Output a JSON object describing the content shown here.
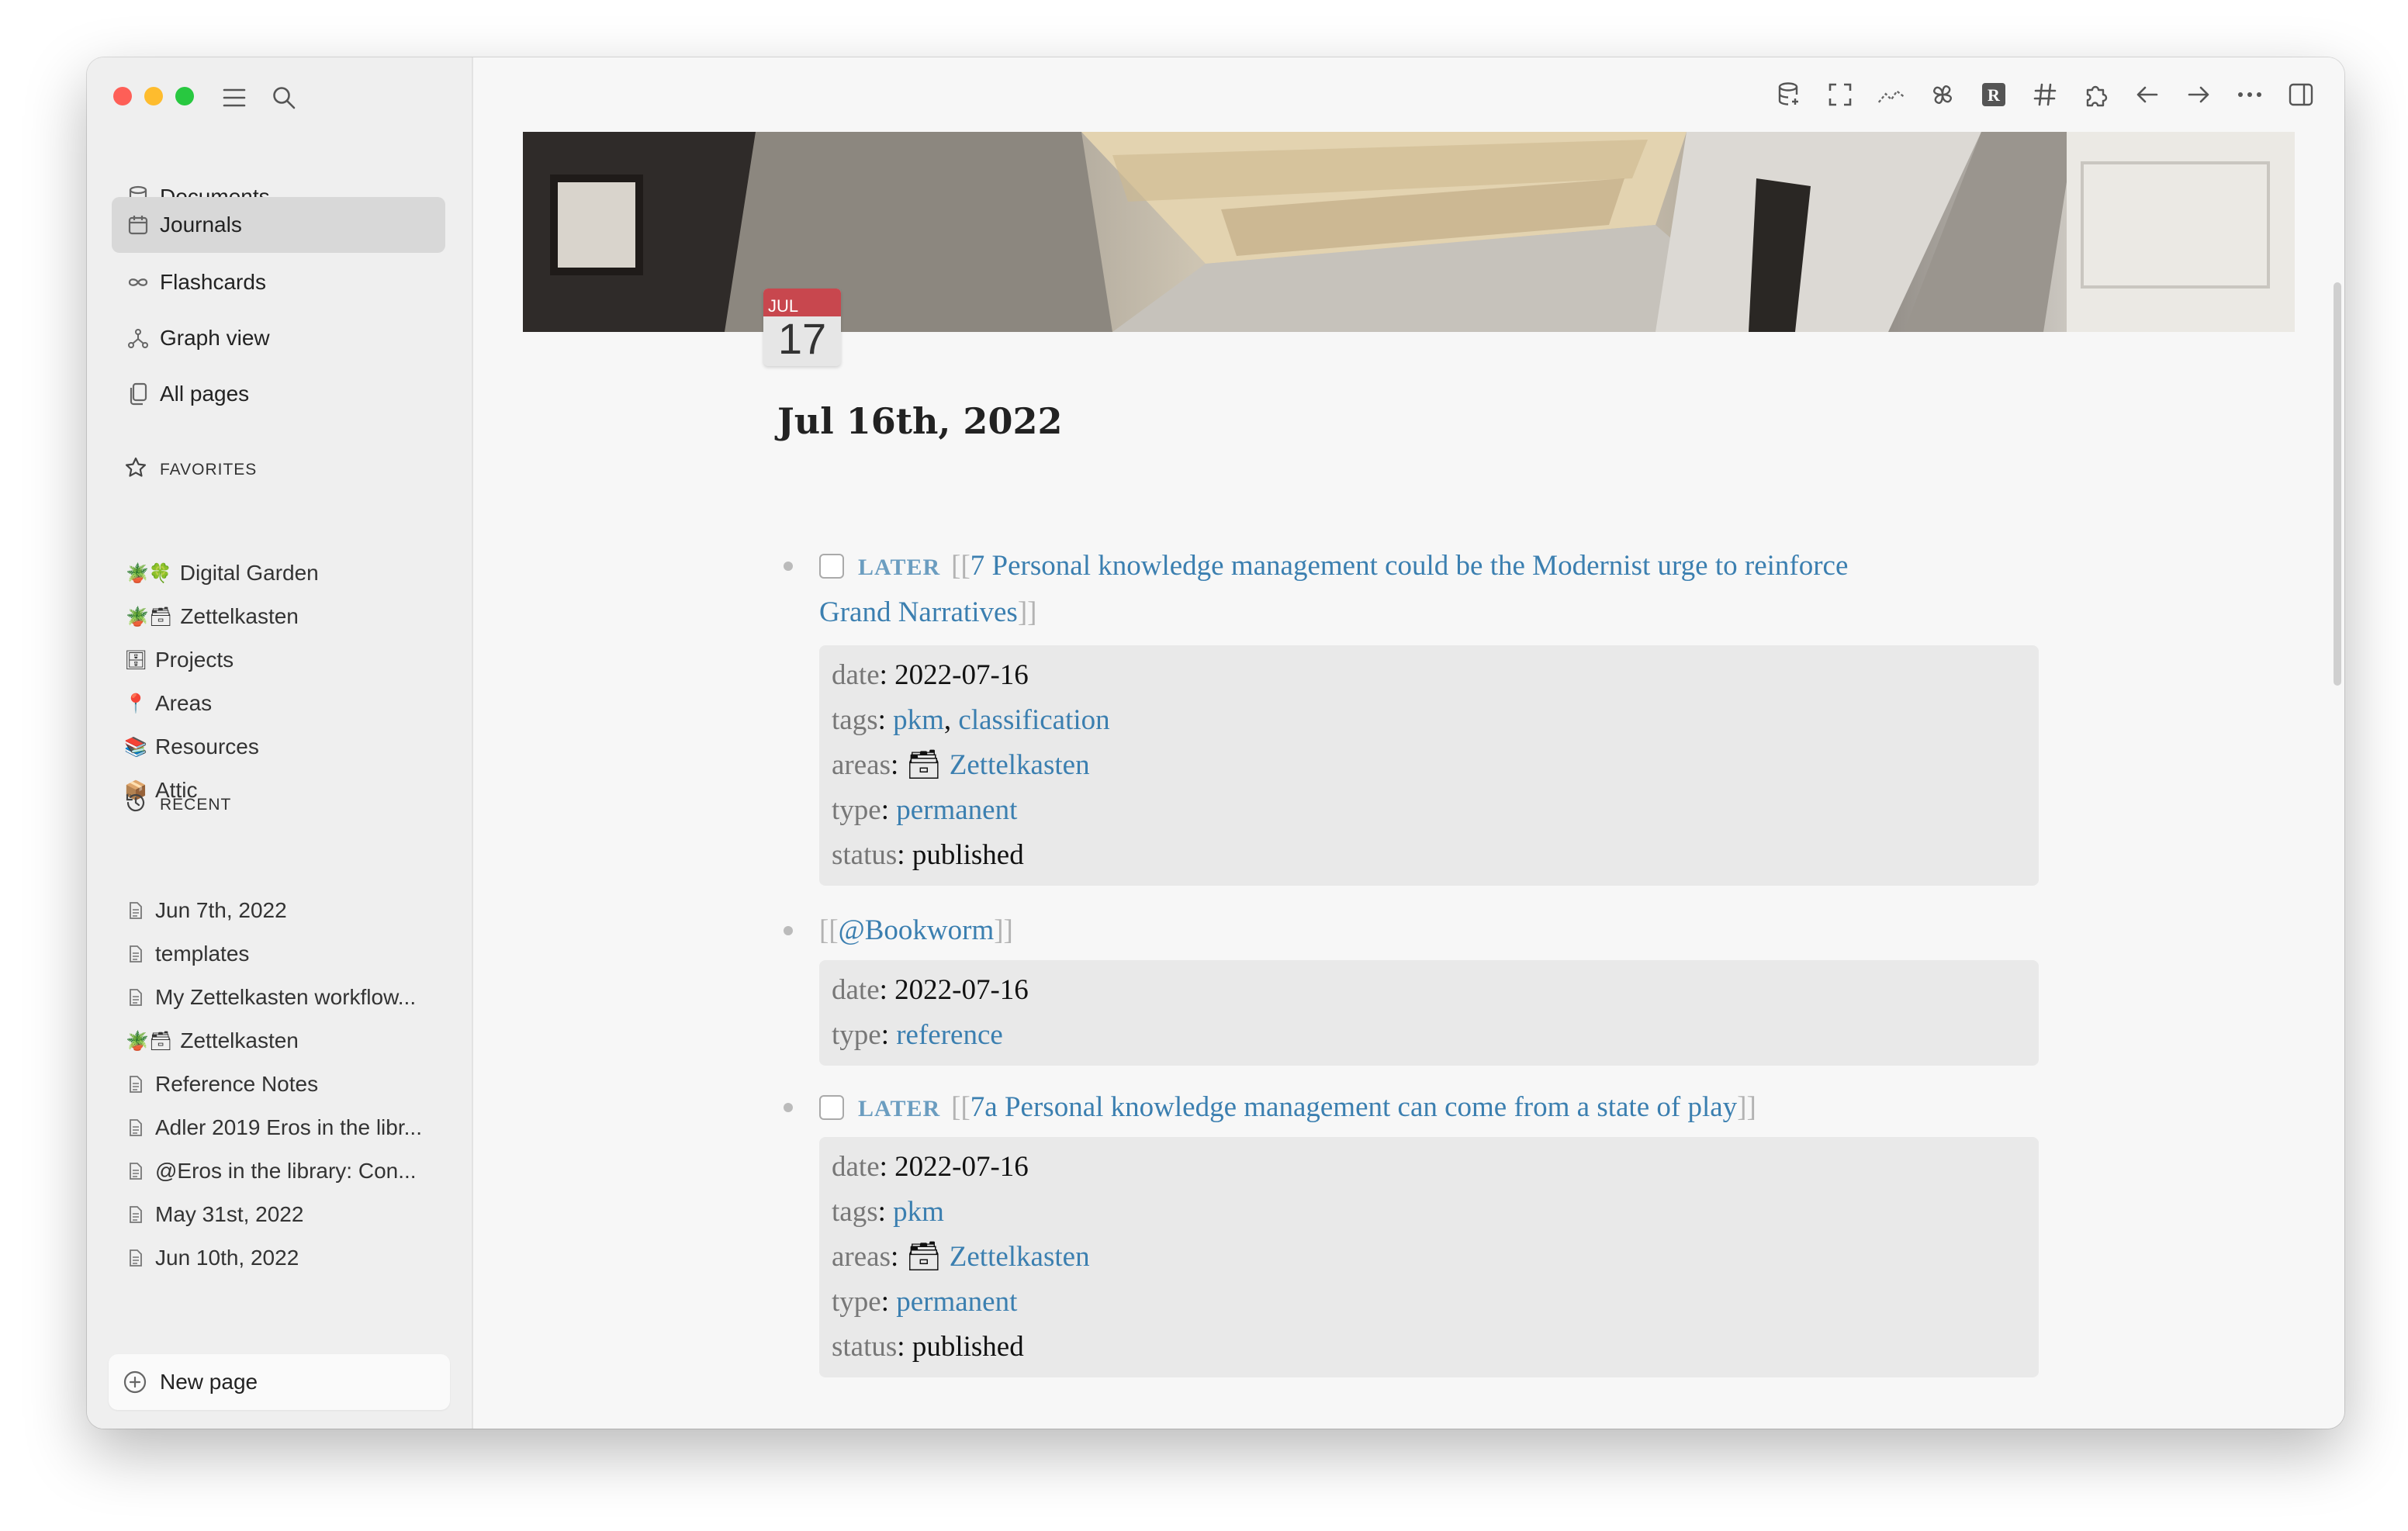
{
  "sidebar": {
    "nav": [
      {
        "label": "Documents",
        "icon": "database-icon"
      },
      {
        "label": "Journals",
        "icon": "calendar-icon",
        "active": true
      },
      {
        "label": "Flashcards",
        "icon": "infinity-icon"
      },
      {
        "label": "Graph view",
        "icon": "graph-icon"
      },
      {
        "label": "All pages",
        "icon": "pages-icon"
      }
    ],
    "favorites_title": "FAVORITES",
    "favorites": [
      {
        "icon": "🪴🍀",
        "label": "Digital Garden"
      },
      {
        "icon": "🪴🗃",
        "label": "Zettelkasten"
      },
      {
        "icon": "🗄",
        "label": "Projects"
      },
      {
        "icon": "📍",
        "label": "Areas"
      },
      {
        "icon": "📚",
        "label": "Resources"
      },
      {
        "icon": "📦",
        "label": "Attic"
      }
    ],
    "recent_title": "RECENT",
    "recent": [
      {
        "icon": "page",
        "label": "Jun 7th, 2022"
      },
      {
        "icon": "page",
        "label": "templates"
      },
      {
        "icon": "page",
        "label": "My Zettelkasten workflow..."
      },
      {
        "icon": "🪴🗃",
        "label": "Zettelkasten"
      },
      {
        "icon": "page",
        "label": "Reference Notes"
      },
      {
        "icon": "page",
        "label": "Adler 2019 Eros in the libr..."
      },
      {
        "icon": "page",
        "label": "@Eros in the library: Con..."
      },
      {
        "icon": "page",
        "label": "May 31st, 2022"
      },
      {
        "icon": "page",
        "label": "Jun 10th, 2022"
      }
    ],
    "new_page": "New page"
  },
  "toolbar": {
    "icons": [
      "database-icon",
      "fullscreen-icon",
      "sparkline-icon",
      "pinwheel-icon",
      "r-badge-icon",
      "hashtag-icon",
      "puzzle-icon",
      "arrow-left-icon",
      "arrow-right-icon",
      "more-icon",
      "sidebar-toggle-icon"
    ]
  },
  "calendar_badge": {
    "month": "JUL",
    "day": "17"
  },
  "page": {
    "title": "Jul 16th, 2022",
    "blocks": [
      {
        "marker": "LATER",
        "open": "[[",
        "link_line1": "7 Personal knowledge management could be the Modernist urge to reinforce",
        "link_line2": "Grand Narratives",
        "close": "]]",
        "props": {
          "date_key": "date",
          "date_val": "2022-07-16",
          "tags_key": "tags",
          "tag1": "pkm",
          "tag_sep": ",",
          "tag2": "classification",
          "areas_key": "areas",
          "areas_icon": "🗃",
          "areas_val": "Zettelkasten",
          "type_key": "type",
          "type_val": "permanent",
          "status_key": "status",
          "status_val": "published"
        }
      },
      {
        "open": "[[",
        "link": "@Bookworm",
        "close": "]]",
        "props": {
          "date_key": "date",
          "date_val": "2022-07-16",
          "type_key": "type",
          "type_val": "reference"
        }
      },
      {
        "marker": "LATER",
        "open": "[[",
        "link": "7a Personal knowledge management can come from a state of play",
        "close": "]]",
        "props": {
          "date_key": "date",
          "date_val": "2022-07-16",
          "tags_key": "tags",
          "tag1": "pkm",
          "areas_key": "areas",
          "areas_icon": "🗃",
          "areas_val": "Zettelkasten",
          "type_key": "type",
          "type_val": "permanent",
          "status_key": "status",
          "status_val": "published"
        }
      }
    ]
  }
}
